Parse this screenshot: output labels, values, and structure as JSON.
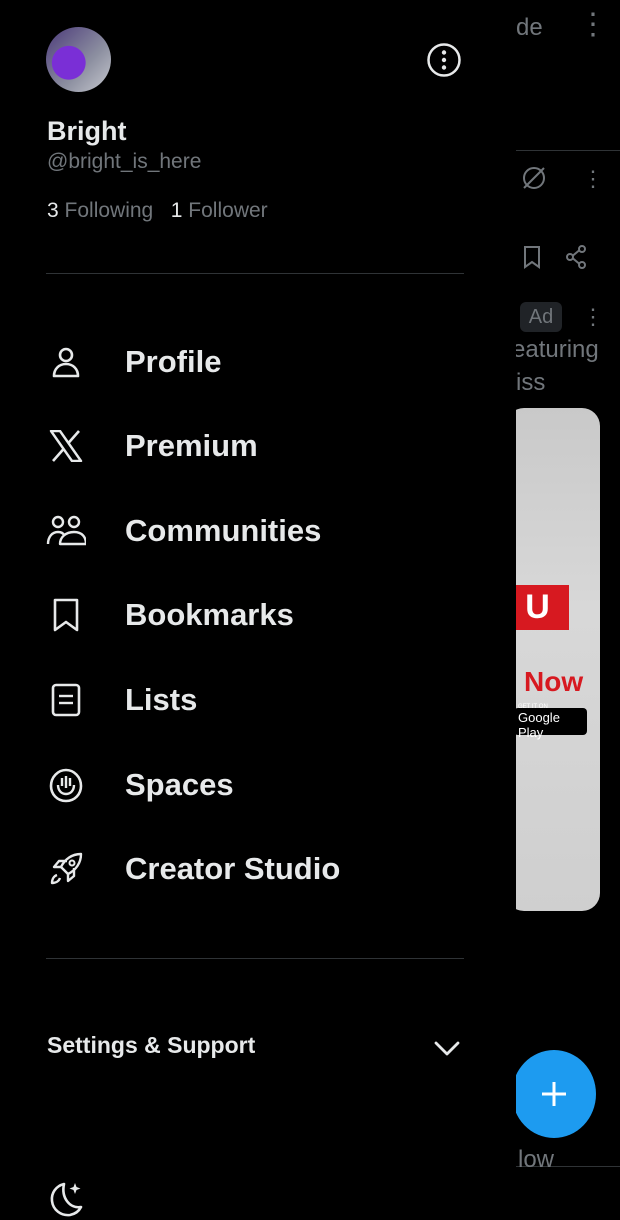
{
  "background": {
    "top_fragment": "de",
    "ad_badge": "Ad",
    "ad_text_1": "eaturing",
    "ad_text_2": "iss",
    "ad_red_text": "U",
    "ad_now": "Now",
    "ad_gp_small": "GET IT ON",
    "ad_gp": "Google Play",
    "bottom_fragment": "low"
  },
  "profile": {
    "name": "Bright",
    "handle": "@bright_is_here",
    "following_count": "3",
    "following_label": "Following",
    "follower_count": "1",
    "follower_label": "Follower"
  },
  "menu": [
    {
      "label": "Profile",
      "icon": "person-icon"
    },
    {
      "label": "Premium",
      "icon": "x-logo-icon"
    },
    {
      "label": "Communities",
      "icon": "communities-icon"
    },
    {
      "label": "Bookmarks",
      "icon": "bookmark-icon"
    },
    {
      "label": "Lists",
      "icon": "list-icon"
    },
    {
      "label": "Spaces",
      "icon": "spaces-icon"
    },
    {
      "label": "Creator Studio",
      "icon": "rocket-icon"
    }
  ],
  "settings": {
    "label": "Settings & Support"
  },
  "colors": {
    "accent": "#1d9bf0",
    "text": "#e7e9ea",
    "muted": "#71767b",
    "divider": "#2f3336"
  }
}
